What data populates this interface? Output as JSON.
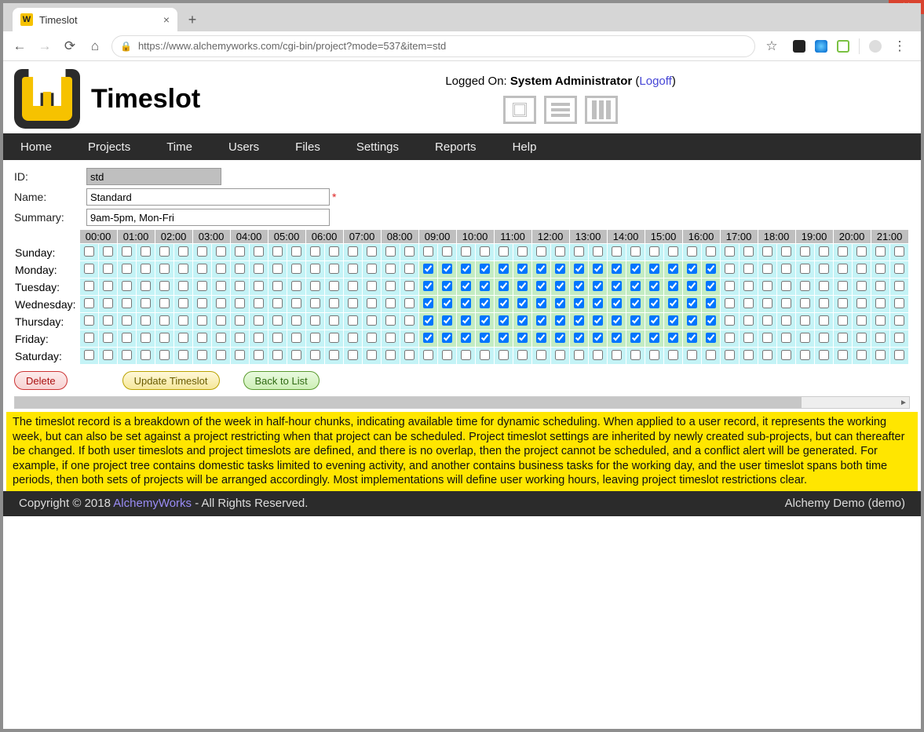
{
  "browser": {
    "tab_title": "Timeslot",
    "url": "https://www.alchemyworks.com/cgi-bin/project?mode=537&item=std"
  },
  "header": {
    "page_title": "Timeslot",
    "logged_prefix": "Logged On: ",
    "logged_user": "System Administrator",
    "logoff_label": "Logoff"
  },
  "menu": {
    "items": [
      "Home",
      "Projects",
      "Time",
      "Users",
      "Files",
      "Settings",
      "Reports",
      "Help"
    ]
  },
  "form": {
    "id_label": "ID:",
    "id_value": "std",
    "name_label": "Name:",
    "name_value": "Standard",
    "summary_label": "Summary:",
    "summary_value": "9am-5pm, Mon-Fri"
  },
  "slots": {
    "hours": [
      "00:00",
      "01:00",
      "02:00",
      "03:00",
      "04:00",
      "05:00",
      "06:00",
      "07:00",
      "08:00",
      "09:00",
      "10:00",
      "11:00",
      "12:00",
      "13:00",
      "14:00",
      "15:00",
      "16:00",
      "17:00",
      "18:00",
      "19:00",
      "20:00",
      "21:00"
    ],
    "days": [
      "Sunday:",
      "Monday:",
      "Tuesday:",
      "Wednesday:",
      "Thursday:",
      "Friday:",
      "Saturday:"
    ],
    "checked_days": [
      false,
      true,
      true,
      true,
      true,
      true,
      false
    ],
    "checked_start_halfhour_index": 18,
    "checked_end_halfhour_index": 34
  },
  "buttons": {
    "delete": "Delete",
    "update": "Update Timeslot",
    "back": "Back to List"
  },
  "help_text": "The timeslot record is a breakdown of the week in half-hour chunks, indicating available time for dynamic scheduling. When applied to a user record, it represents the working week, but can also be set against a project restricting when that project can be scheduled. Project timeslot settings are inherited by newly created sub-projects, but can thereafter be changed. If both user timeslots and project timeslots are defined, and there is no overlap, then the project cannot be scheduled, and a conflict alert will be generated. For example, if one project tree contains domestic tasks limited to evening activity, and another contains business tasks for the working day, and the user timeslot spans both time periods, then both sets of projects will be arranged accordingly. Most implementations will define user working hours, leaving project timeslot restrictions clear.",
  "footer": {
    "copyright_prefix": "Copyright © 2018 ",
    "link_label": "AlchemyWorks",
    "copyright_suffix": " - All Rights Reserved.",
    "right": "Alchemy Demo (demo)"
  }
}
